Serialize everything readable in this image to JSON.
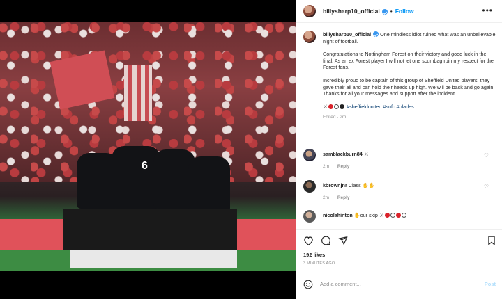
{
  "post": {
    "username": "billysharp10_official",
    "follow_label": "Follow",
    "caption_username": "billysharp10_official",
    "caption_p1": "One mindless idiot ruined what was an unbelievable night of football.",
    "caption_p2": "Congratulations to Nottingham Forest on their victory and good luck in the final. As an ex Forest player I will not let one scumbag ruin my respect for the Forest fans.",
    "caption_p3": "Incredibly proud to be captain of this group of Sheffield United players, they gave their all and can hold their heads up high. We will be back and go again. Thanks for all your messages and support after the incident.",
    "hashtags": "#sheffieldunited #sufc #blades",
    "edited": "Edited · 2m",
    "likes": "192 likes",
    "timestamp": "3 MINUTES AGO"
  },
  "comments": [
    {
      "username": "samblackburn84",
      "text": "",
      "time": "2m",
      "reply": "Reply"
    },
    {
      "username": "kbrownjnr",
      "text": "Class",
      "time": "2m",
      "reply": "Reply"
    },
    {
      "username": "nicolahinton",
      "text": "our skip",
      "time": "",
      "reply": ""
    }
  ],
  "add_comment": {
    "placeholder": "Add a comment...",
    "post_label": "Post"
  },
  "colors": {
    "link": "#0095f6",
    "verified": "#3897f0",
    "hashtag": "#00376b"
  },
  "icons": [
    "heart-icon",
    "comment-icon",
    "share-icon",
    "bookmark-icon",
    "emoji-icon",
    "more-icon",
    "verified-icon"
  ]
}
